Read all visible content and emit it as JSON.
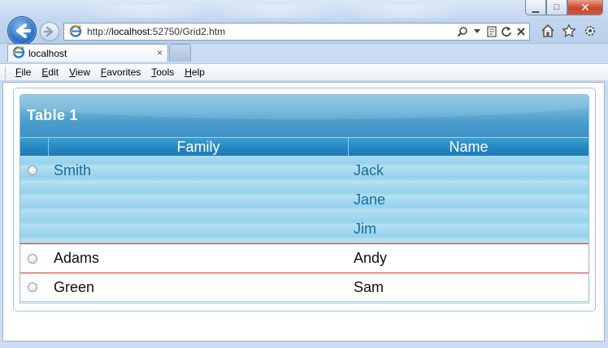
{
  "browser": {
    "address": {
      "protocol": "http://",
      "host": "localhost",
      "rest": ":52750/Grid2.htm"
    },
    "tab_title": "localhost",
    "tab_close": "×",
    "window_controls": {
      "minimize": "▁",
      "maximize": "□",
      "close": "✕"
    }
  },
  "menu": {
    "items": [
      "File",
      "Edit",
      "View",
      "Favorites",
      "Tools",
      "Help"
    ]
  },
  "grid": {
    "caption": "Table 1",
    "columns": [
      "Family",
      "Name"
    ],
    "rows": [
      {
        "family": "Smith",
        "names": [
          "Jack",
          "Jane",
          "Jim"
        ],
        "selected": true
      },
      {
        "family": "Adams",
        "names": [
          "Andy"
        ],
        "selected": false
      },
      {
        "family": "Green",
        "names": [
          "Sam"
        ],
        "selected": false
      }
    ]
  },
  "colors": {
    "header_blue": "#2585c0",
    "selected_row_blue": "#a9dbf0",
    "selected_text": "#1a6b9a",
    "row_divider_red": "#d0322c"
  },
  "icons": {
    "back": "back-arrow-icon",
    "forward": "forward-arrow-icon",
    "ie": "ie-logo-icon",
    "search": "search-icon",
    "compat": "compatibility-view-icon",
    "refresh": "refresh-icon",
    "stop": "stop-icon",
    "home": "home-icon",
    "favorites": "favorites-star-icon",
    "tools": "gear-icon"
  }
}
